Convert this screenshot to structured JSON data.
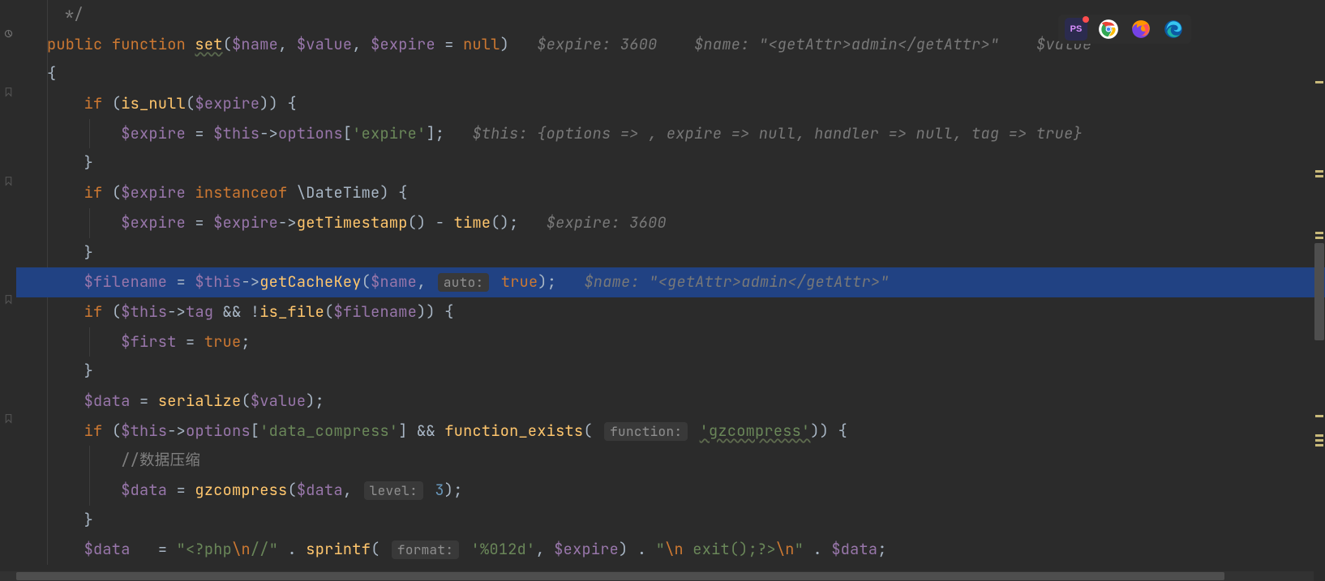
{
  "code": {
    "l0_cmt": "*/",
    "l1": {
      "kw1": "public",
      "kw2": "function",
      "fn": "set",
      "p": "(",
      "v1": "$name",
      "c1": ", ",
      "v2": "$value",
      "c2": ", ",
      "v3": "$expire",
      "eq": " = ",
      "null": "null",
      "cp": ")",
      "h1": "$expire: 3600",
      "h2": "$name: \"<getAttr>admin</getAttr>\"",
      "h3": "$value"
    },
    "l2": "{",
    "l3": {
      "kw": "if",
      "sp": " (",
      "fn": "is_null",
      "p": "(",
      "v": "$expire",
      "cp": ")) {"
    },
    "l4": {
      "v1": "$expire",
      "eq": " = ",
      "v2": "$this",
      "arr": "->",
      "prop": "options",
      "b1": "[",
      "s": "'expire'",
      "b2": "];",
      "h": "$this: {options => , expire => null, handler => null, tag => true}"
    },
    "l5": "}",
    "l6": {
      "kw1": "if",
      "sp": " (",
      "v": "$expire",
      "kw2": " instanceof ",
      "cls": "\\DateTime",
      "cp": ") {"
    },
    "l7": {
      "v1": "$expire",
      "eq": " = ",
      "v2": "$expire",
      "arr": "->",
      "fn": "getTimestamp",
      "p": "() - ",
      "fn2": "time",
      "p2": "();",
      "h": "$expire: 3600"
    },
    "l8": "}",
    "l9": {
      "v1": "$filename",
      "eq": " = ",
      "v2": "$this",
      "arr": "->",
      "fn": "getCacheKey",
      "p": "(",
      "v3": "$name",
      "c": ",",
      "ph": "auto:",
      "tr": "true",
      "cp": ");",
      "h": "$name: \"<getAttr>admin</getAttr>\""
    },
    "l10": {
      "kw": "if",
      "sp": " (",
      "v1": "$this",
      "arr": "->",
      "prop": "tag",
      "and": " && !",
      "fn": "is_file",
      "p": "(",
      "v2": "$filename",
      "cp": ")) {"
    },
    "l11": {
      "v": "$first",
      "eq": " = ",
      "tr": "true",
      "sc": ";"
    },
    "l12": "}",
    "l13": {
      "v1": "$data",
      "eq": " = ",
      "fn": "serialize",
      "p": "(",
      "v2": "$value",
      "cp": ");"
    },
    "l14": {
      "kw": "if",
      "sp": " (",
      "v": "$this",
      "arr": "->",
      "prop": "options",
      "b1": "[",
      "s": "'data_compress'",
      "b2": "] && ",
      "fn": "function_exists",
      "p": "(",
      "ph": "function:",
      "s2": "'gzcompress'",
      "cp": ")) {"
    },
    "l15": {
      "cmt": "//数据压缩"
    },
    "l16": {
      "v1": "$data",
      "eq": " = ",
      "fn": "gzcompress",
      "p": "(",
      "v2": "$data",
      "c": ",",
      "ph": "level:",
      "n": "3",
      "cp": ");"
    },
    "l17": "}",
    "l18": {
      "v1": "$data",
      "eq": "   = ",
      "q1": "\"",
      "s1": "<?php",
      "e1": "\\n",
      "s1b": "//",
      "q1c": "\"",
      "dot1": " . ",
      "fn": "sprintf",
      "p": "(",
      "ph": "format:",
      "s2": "'%012d'",
      "c1": ", ",
      "v2": "$expire",
      "cp": ") . ",
      "q2": "\"",
      "e2": "\\n ",
      "s3": "exit();?>",
      "e3": "\\n",
      "q2c": "\"",
      "dot2": " . ",
      "v3": "$data",
      "sc": ";"
    }
  },
  "taskbar": {
    "apps": [
      "phpstorm",
      "chrome",
      "firefox",
      "edge"
    ]
  }
}
